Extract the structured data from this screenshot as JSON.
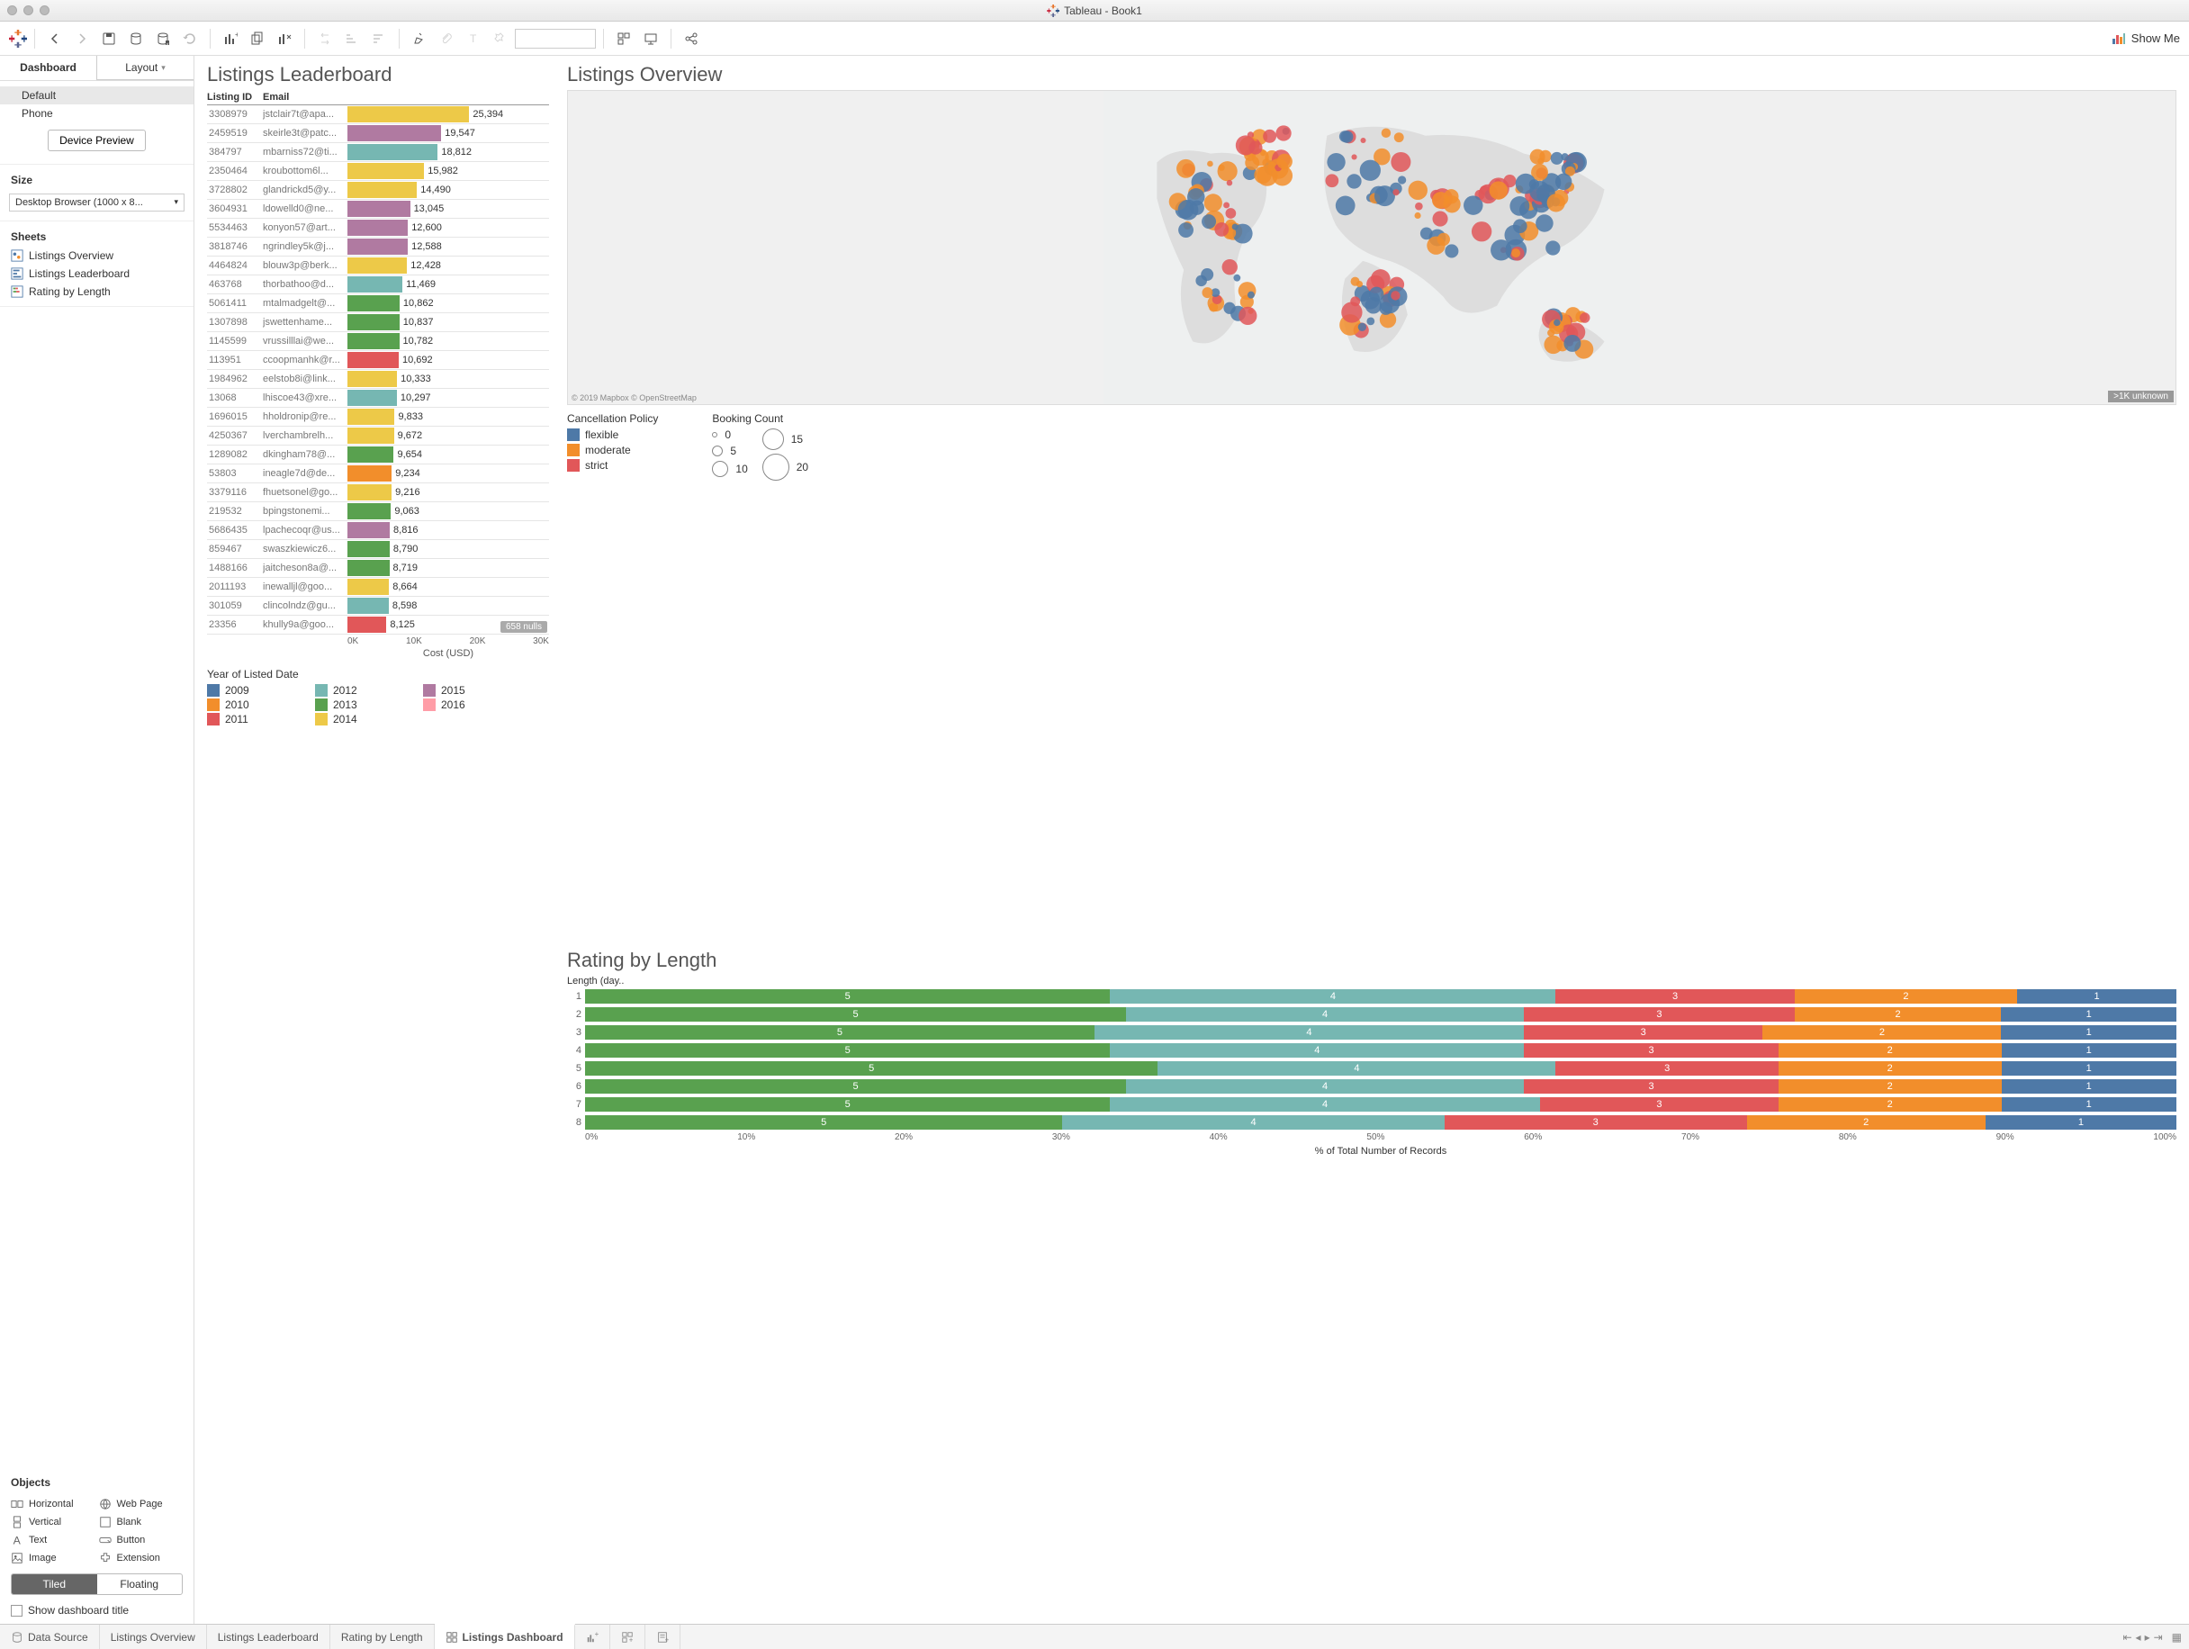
{
  "window": {
    "title": "Tableau - Book1"
  },
  "showme": "Show Me",
  "sidebar": {
    "tabs": [
      "Dashboard",
      "Layout"
    ],
    "default": "Default",
    "phone": "Phone",
    "device_preview": "Device Preview",
    "size_label": "Size",
    "size_value": "Desktop Browser (1000 x 8...",
    "sheets_label": "Sheets",
    "sheets": [
      "Listings Overview",
      "Listings Leaderboard",
      "Rating by Length"
    ],
    "objects_label": "Objects",
    "objects": [
      "Horizontal",
      "Web Page",
      "Vertical",
      "Blank",
      "Text",
      "Button",
      "Image",
      "Extension"
    ],
    "tiled": "Tiled",
    "floating": "Floating",
    "show_title": "Show dashboard title"
  },
  "leaderboard": {
    "title": "Listings Leaderboard",
    "col_id": "Listing ID",
    "col_email": "Email",
    "axis_label": "Cost (USD)",
    "axis_ticks": [
      "0K",
      "10K",
      "20K",
      "30K"
    ],
    "nulls": "658 nulls",
    "max": 30000
  },
  "overview": {
    "title": "Listings Overview",
    "attr": "© 2019 Mapbox © OpenStreetMap",
    "unknown": ">1K unknown",
    "cancel_label": "Cancellation Policy",
    "cancel_items": [
      {
        "label": "flexible",
        "color": "#4e79a7"
      },
      {
        "label": "moderate",
        "color": "#f28e2b"
      },
      {
        "label": "strict",
        "color": "#e15759"
      }
    ],
    "booking_label": "Booking Count",
    "booking_sizes": [
      {
        "label": "0",
        "r": 3
      },
      {
        "label": "5",
        "r": 6
      },
      {
        "label": "10",
        "r": 9
      },
      {
        "label": "15",
        "r": 12
      },
      {
        "label": "20",
        "r": 15
      }
    ]
  },
  "rating": {
    "title": "Rating by Length",
    "sub": "Length (day..",
    "axis_label": "% of Total Number of Records",
    "ticks": [
      "0%",
      "10%",
      "20%",
      "30%",
      "40%",
      "50%",
      "60%",
      "70%",
      "80%",
      "90%",
      "100%"
    ]
  },
  "year_legend": {
    "title": "Year of Listed Date",
    "items": [
      {
        "y": "2009",
        "c": "#4e79a7"
      },
      {
        "y": "2012",
        "c": "#76b7b2"
      },
      {
        "y": "2015",
        "c": "#b07aa1"
      },
      {
        "y": "2010",
        "c": "#f28e2b"
      },
      {
        "y": "2013",
        "c": "#59a14f"
      },
      {
        "y": "2016",
        "c": "#ff9da7"
      },
      {
        "y": "2011",
        "c": "#e15759"
      },
      {
        "y": "2014",
        "c": "#edc948"
      }
    ]
  },
  "bottom_tabs": {
    "data_source": "Data Source",
    "tabs": [
      "Listings Overview",
      "Listings Leaderboard",
      "Rating by Length",
      "Listings Dashboard"
    ]
  },
  "chart_data": {
    "leaderboard": {
      "type": "bar",
      "xlabel": "Cost (USD)",
      "xlim": [
        0,
        30000
      ],
      "rows": [
        {
          "id": "3308979",
          "email": "jstclair7t@apa...",
          "value": 25394,
          "color": "#edc948"
        },
        {
          "id": "2459519",
          "email": "skeirle3t@patc...",
          "value": 19547,
          "color": "#b07aa1"
        },
        {
          "id": "384797",
          "email": "mbarniss72@ti...",
          "value": 18812,
          "color": "#76b7b2"
        },
        {
          "id": "2350464",
          "email": "kroubottom6l...",
          "value": 15982,
          "color": "#edc948"
        },
        {
          "id": "3728802",
          "email": "glandrickd5@y...",
          "value": 14490,
          "color": "#edc948"
        },
        {
          "id": "3604931",
          "email": "ldowelld0@ne...",
          "value": 13045,
          "color": "#b07aa1"
        },
        {
          "id": "5534463",
          "email": "konyon57@art...",
          "value": 12600,
          "color": "#b07aa1"
        },
        {
          "id": "3818746",
          "email": "ngrindley5k@j...",
          "value": 12588,
          "color": "#b07aa1"
        },
        {
          "id": "4464824",
          "email": "blouw3p@berk...",
          "value": 12428,
          "color": "#edc948"
        },
        {
          "id": "463768",
          "email": "thorbathoo@d...",
          "value": 11469,
          "color": "#76b7b2"
        },
        {
          "id": "5061411",
          "email": "mtalmadgelt@...",
          "value": 10862,
          "color": "#59a14f"
        },
        {
          "id": "1307898",
          "email": "jswettenhame...",
          "value": 10837,
          "color": "#59a14f"
        },
        {
          "id": "1145599",
          "email": "vrussilllai@we...",
          "value": 10782,
          "color": "#59a14f"
        },
        {
          "id": "113951",
          "email": "ccoopmanhk@r...",
          "value": 10692,
          "color": "#e15759"
        },
        {
          "id": "1984962",
          "email": "eelstob8i@link...",
          "value": 10333,
          "color": "#edc948"
        },
        {
          "id": "13068",
          "email": "lhiscoe43@xre...",
          "value": 10297,
          "color": "#76b7b2"
        },
        {
          "id": "1696015",
          "email": "hholdronip@re...",
          "value": 9833,
          "color": "#edc948"
        },
        {
          "id": "4250367",
          "email": "lverchambrelh...",
          "value": 9672,
          "color": "#edc948"
        },
        {
          "id": "1289082",
          "email": "dkingham78@...",
          "value": 9654,
          "color": "#59a14f"
        },
        {
          "id": "53803",
          "email": "ineagle7d@de...",
          "value": 9234,
          "color": "#f28e2b"
        },
        {
          "id": "3379116",
          "email": "fhuetsonel@go...",
          "value": 9216,
          "color": "#edc948"
        },
        {
          "id": "219532",
          "email": "bpingstonemi...",
          "value": 9063,
          "color": "#59a14f"
        },
        {
          "id": "5686435",
          "email": "lpachecoqr@us...",
          "value": 8816,
          "color": "#b07aa1"
        },
        {
          "id": "859467",
          "email": "swaszkiewicz6...",
          "value": 8790,
          "color": "#59a14f"
        },
        {
          "id": "1488166",
          "email": "jaitcheson8a@...",
          "value": 8719,
          "color": "#59a14f"
        },
        {
          "id": "2011193",
          "email": "inewalljl@goo...",
          "value": 8664,
          "color": "#edc948"
        },
        {
          "id": "301059",
          "email": "clincolndz@gu...",
          "value": 8598,
          "color": "#76b7b2"
        },
        {
          "id": "23356",
          "email": "khully9a@goo...",
          "value": 8125,
          "color": "#e15759"
        }
      ]
    },
    "rating": {
      "type": "stacked-bar-100",
      "xlabel": "% of Total Number of Records",
      "categories": [
        1,
        2,
        3,
        4,
        5,
        6,
        7,
        8
      ],
      "segments": [
        {
          "rating": 5,
          "color": "#59a14f"
        },
        {
          "rating": 4,
          "color": "#76b7b2"
        },
        {
          "rating": 3,
          "color": "#e15759"
        },
        {
          "rating": 2,
          "color": "#f28e2b"
        },
        {
          "rating": 1,
          "color": "#4e79a7"
        }
      ],
      "values": [
        [
          33,
          28,
          15,
          14,
          10
        ],
        [
          34,
          25,
          17,
          13,
          11
        ],
        [
          32,
          27,
          15,
          15,
          11
        ],
        [
          33,
          26,
          16,
          14,
          11
        ],
        [
          36,
          25,
          14,
          14,
          11
        ],
        [
          34,
          25,
          16,
          14,
          11
        ],
        [
          33,
          27,
          15,
          14,
          11
        ],
        [
          30,
          24,
          19,
          15,
          12
        ]
      ]
    }
  }
}
